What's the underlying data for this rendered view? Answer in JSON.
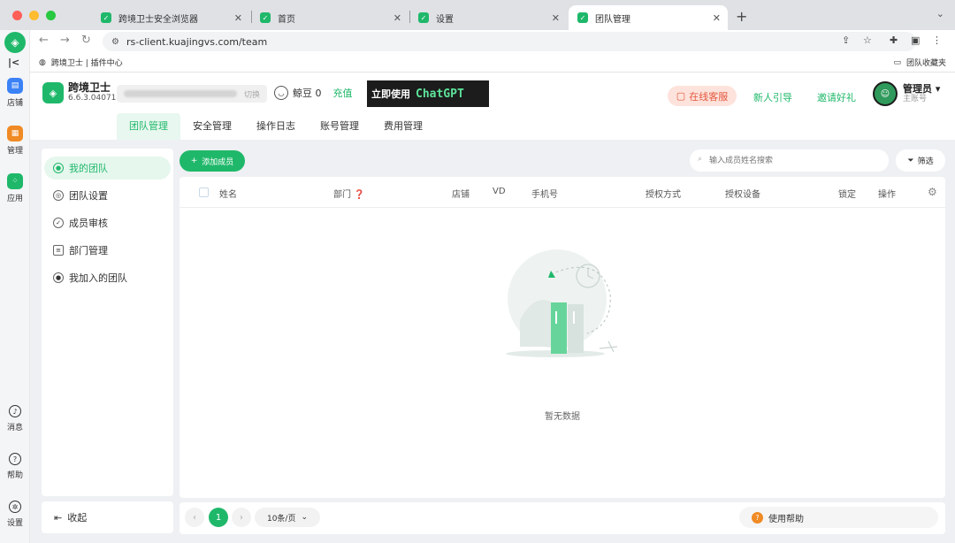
{
  "browser": {
    "tabs": [
      {
        "title": "跨境卫士安全浏览器",
        "active": false
      },
      {
        "title": "首页",
        "active": false
      },
      {
        "title": "设置",
        "active": false
      },
      {
        "title": "团队管理",
        "active": true
      }
    ],
    "url": "rs-client.kuajingvs.com/team",
    "bookmark_left": "跨境卫士 | 插件中心",
    "bookmark_right": "团队收藏夹"
  },
  "rail": {
    "items": [
      {
        "label": "店铺",
        "icon": "store-icon",
        "color": "#3b82f6"
      },
      {
        "label": "管理",
        "icon": "manage-icon",
        "color": "#f08a24"
      },
      {
        "label": "应用",
        "icon": "apps-icon",
        "color": "#1fb86a"
      }
    ],
    "bottom": [
      {
        "label": "消息",
        "icon": "bell-icon"
      },
      {
        "label": "帮助",
        "icon": "help-icon"
      },
      {
        "label": "设置",
        "icon": "gear-icon"
      }
    ]
  },
  "header": {
    "brand_name": "跨境卫士",
    "version": "6.6.3.04071",
    "switch_label": "切换",
    "beans_label": "鲸豆 0",
    "recharge_label": "充值",
    "promo_text": "立即使用",
    "promo_brand": "ChatGPT",
    "service_label": "在线客服",
    "guide_label": "新人引导",
    "invite_label": "邀请好礼",
    "user_role": "管理员",
    "user_sub": "主账号",
    "tabs": [
      "团队管理",
      "安全管理",
      "操作日志",
      "账号管理",
      "费用管理"
    ],
    "active_tab": 0
  },
  "sidebar": {
    "items": [
      {
        "label": "我的团队",
        "active": true
      },
      {
        "label": "团队设置",
        "active": false
      },
      {
        "label": "成员审核",
        "active": false
      },
      {
        "label": "部门管理",
        "active": false
      },
      {
        "label": "我加入的团队",
        "active": false
      }
    ],
    "collapse_label": "收起"
  },
  "main": {
    "add_label": "添加成员",
    "search_placeholder": "输入成员姓名搜索",
    "filter_label": "筛选",
    "columns": [
      "姓名",
      "部门",
      "店铺",
      "VD",
      "手机号",
      "授权方式",
      "授权设备",
      "锁定",
      "操作"
    ],
    "empty_text": "暂无数据",
    "pager": {
      "current": "1",
      "page_size": "10条/页"
    },
    "help_label": "使用帮助"
  },
  "colors": {
    "accent": "#1fb86a",
    "service": "#e4573d"
  }
}
